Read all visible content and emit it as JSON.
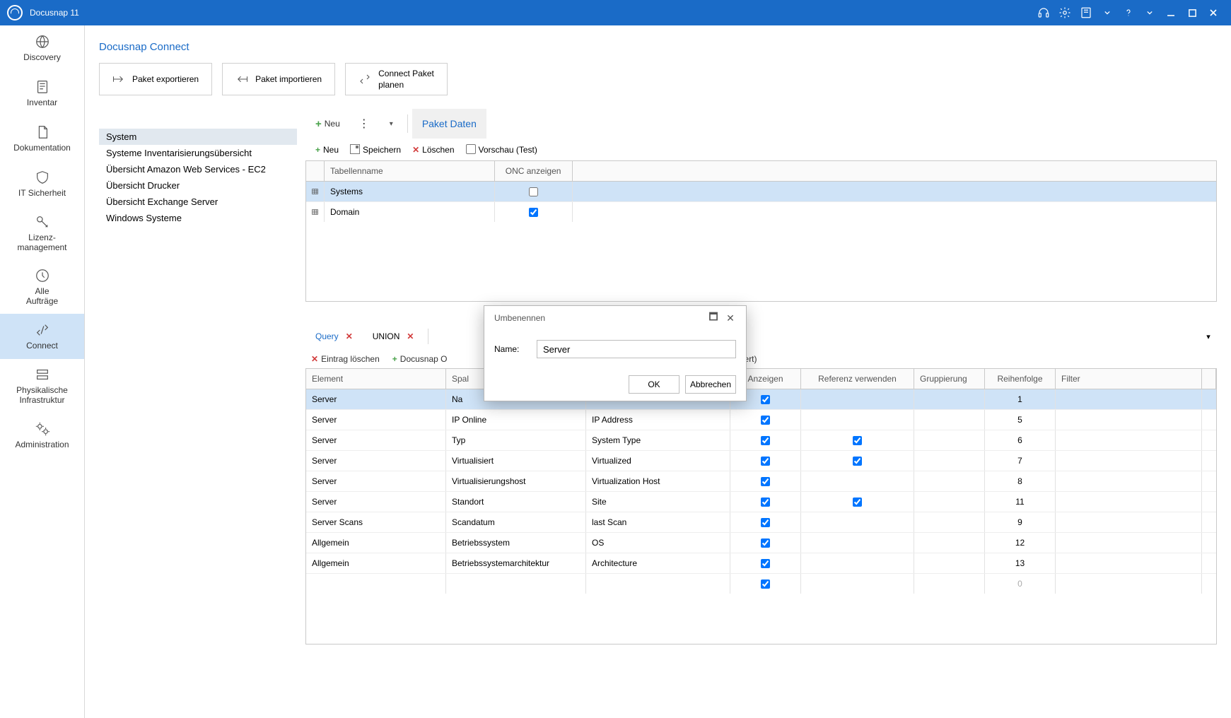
{
  "titlebar": {
    "title": "Docusnap 11"
  },
  "leftnav": {
    "items": [
      {
        "id": "discovery",
        "label": "Discovery"
      },
      {
        "id": "inventar",
        "label": "Inventar"
      },
      {
        "id": "dokumentation",
        "label": "Dokumentation"
      },
      {
        "id": "it-sicherheit",
        "label": "IT Sicherheit"
      },
      {
        "id": "lizenz",
        "label": "Lizenz-\nmanagement"
      },
      {
        "id": "auftraege",
        "label": "Alle\nAufträge"
      },
      {
        "id": "connect",
        "label": "Connect"
      },
      {
        "id": "phys",
        "label": "Physikalische\nInfrastruktur"
      },
      {
        "id": "admin",
        "label": "Administration"
      }
    ]
  },
  "breadcrumb": "Docusnap Connect",
  "ribbon": {
    "export": "Paket exportieren",
    "import": "Paket importieren",
    "plan_line1": "Connect Paket",
    "plan_line2": "planen"
  },
  "packages": {
    "items": [
      "System",
      "Systeme Inventarisierungsübersicht",
      "Übersicht Amazon Web Services - EC2",
      "Übersicht Drucker",
      "Übersicht Exchange Server",
      "Windows Systeme"
    ],
    "selected": 0
  },
  "topStrip": {
    "neu": "Neu",
    "paketDaten": "Paket Daten"
  },
  "topToolbar": {
    "neu": "Neu",
    "speichern": "Speichern",
    "loeschen": "Löschen",
    "vorschau": "Vorschau (Test)"
  },
  "topGrid": {
    "headers": [
      "Tabellenname",
      "ONC anzeigen"
    ],
    "rows": [
      {
        "name": "Systems",
        "onc": false,
        "selected": true
      },
      {
        "name": "Domain",
        "onc": true,
        "selected": false
      }
    ]
  },
  "queryTabs": {
    "tabs": [
      {
        "label": "Query",
        "active": true
      },
      {
        "label": "UNION",
        "active": false
      }
    ]
  },
  "queryToolbar": {
    "delete": "Eintrag löschen",
    "docusnapO": "Docusnap O",
    "definiert_suffix": "efiniert)"
  },
  "btmGrid": {
    "headers": [
      "Element",
      "Spal",
      "",
      "Anzeigen",
      "Referenz verwenden",
      "Gruppierung",
      "Reihenfolge",
      "Filter"
    ],
    "rows": [
      {
        "el": "Server",
        "sp": "Na",
        "al": "",
        "show": true,
        "ref": false,
        "grp": "",
        "ord": "1",
        "sel": true
      },
      {
        "el": "Server",
        "sp": "IP Online",
        "al": "IP Address",
        "show": true,
        "ref": false,
        "grp": "",
        "ord": "5"
      },
      {
        "el": "Server",
        "sp": "Typ",
        "al": "System Type",
        "show": true,
        "ref": true,
        "grp": "",
        "ord": "6"
      },
      {
        "el": "Server",
        "sp": "Virtualisiert",
        "al": "Virtualized",
        "show": true,
        "ref": true,
        "grp": "",
        "ord": "7"
      },
      {
        "el": "Server",
        "sp": "Virtualisierungshost",
        "al": "Virtualization Host",
        "show": true,
        "ref": false,
        "grp": "",
        "ord": "8"
      },
      {
        "el": "Server",
        "sp": "Standort",
        "al": "Site",
        "show": true,
        "ref": true,
        "grp": "",
        "ord": "11"
      },
      {
        "el": "Server Scans",
        "sp": "Scandatum",
        "al": "last Scan",
        "show": true,
        "ref": false,
        "grp": "",
        "ord": "9"
      },
      {
        "el": "Allgemein",
        "sp": "Betriebssystem",
        "al": "OS",
        "show": true,
        "ref": false,
        "grp": "",
        "ord": "12"
      },
      {
        "el": "Allgemein",
        "sp": "Betriebssystemarchitektur",
        "al": "Architecture",
        "show": true,
        "ref": false,
        "grp": "",
        "ord": "13"
      },
      {
        "el": "",
        "sp": "",
        "al": "",
        "show": true,
        "ref": false,
        "grp": "",
        "ord": "0",
        "dim": true
      }
    ]
  },
  "modal": {
    "title": "Umbenennen",
    "nameLabel": "Name:",
    "nameValue": "Server",
    "ok": "OK",
    "cancel": "Abbrechen"
  }
}
